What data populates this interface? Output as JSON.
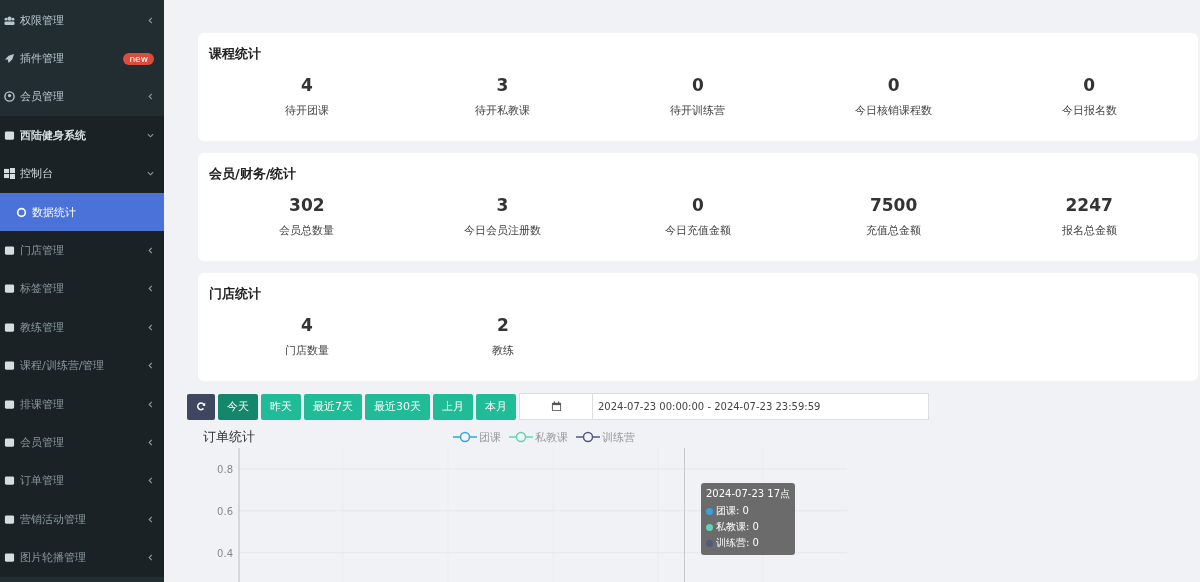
{
  "sidebar": {
    "items": [
      {
        "label": "权限管理",
        "kind": "menu",
        "expanded": false
      },
      {
        "label": "插件管理",
        "kind": "menu",
        "badge": "new"
      },
      {
        "label": "会员管理",
        "kind": "menu",
        "expanded": false
      },
      {
        "label": "西陆健身系统",
        "kind": "group",
        "expanded": true,
        "children": [
          {
            "label": "控制台",
            "kind": "menu",
            "expanded": true,
            "children": [
              {
                "label": "数据统计",
                "kind": "leaf",
                "selected": true
              }
            ]
          },
          {
            "label": "门店管理",
            "kind": "menu",
            "expanded": false
          },
          {
            "label": "标签管理",
            "kind": "menu",
            "expanded": false
          },
          {
            "label": "教练管理",
            "kind": "menu",
            "expanded": false
          },
          {
            "label": "课程/训练营/管理",
            "kind": "menu",
            "expanded": false
          },
          {
            "label": "排课管理",
            "kind": "menu",
            "expanded": false
          },
          {
            "label": "会员管理",
            "kind": "menu",
            "expanded": false
          },
          {
            "label": "订单管理",
            "kind": "menu",
            "expanded": false
          },
          {
            "label": "营销活动管理",
            "kind": "menu",
            "expanded": false
          },
          {
            "label": "图片轮播管理",
            "kind": "menu",
            "expanded": false
          }
        ]
      }
    ]
  },
  "cards": [
    {
      "title": "课程统计",
      "stats": [
        {
          "value": "4",
          "label": "待开团课"
        },
        {
          "value": "3",
          "label": "待开私教课"
        },
        {
          "value": "0",
          "label": "待开训练营"
        },
        {
          "value": "0",
          "label": "今日核销课程数"
        },
        {
          "value": "0",
          "label": "今日报名数"
        }
      ]
    },
    {
      "title": "会员/财务/统计",
      "stats": [
        {
          "value": "302",
          "label": "会员总数量"
        },
        {
          "value": "3",
          "label": "今日会员注册数"
        },
        {
          "value": "0",
          "label": "今日充值金额"
        },
        {
          "value": "7500",
          "label": "充值总金额"
        },
        {
          "value": "2247",
          "label": "报名总金额"
        }
      ]
    },
    {
      "title": "门店统计",
      "stats": [
        {
          "value": "4",
          "label": "门店数量"
        },
        {
          "value": "2",
          "label": "教练"
        }
      ]
    }
  ],
  "toolbar": {
    "ranges": [
      {
        "label": "今天",
        "selected": true
      },
      {
        "label": "昨天",
        "selected": false
      },
      {
        "label": "最近7天",
        "selected": false
      },
      {
        "label": "最近30天",
        "selected": false
      },
      {
        "label": "上月",
        "selected": false
      },
      {
        "label": "本月",
        "selected": false
      }
    ],
    "date_range": "2024-07-23 00:00:00 - 2024-07-23 23:59:59"
  },
  "order_chart": {
    "title": "订单统计",
    "chart_data": {
      "type": "line",
      "ylim": [
        0.26,
        0.9
      ],
      "grid": true,
      "yticks": [
        0.4,
        0.6,
        0.8
      ],
      "series": [
        {
          "name": "团课",
          "color": "#3ba1da"
        },
        {
          "name": "私教课",
          "color": "#62d4b4"
        },
        {
          "name": "训练营",
          "color": "#515a7c"
        }
      ]
    },
    "tooltip": {
      "title": "2024-07-23 17点",
      "rows": [
        "团课: 0",
        "私教课: 0",
        "训练营: 0"
      ]
    }
  }
}
